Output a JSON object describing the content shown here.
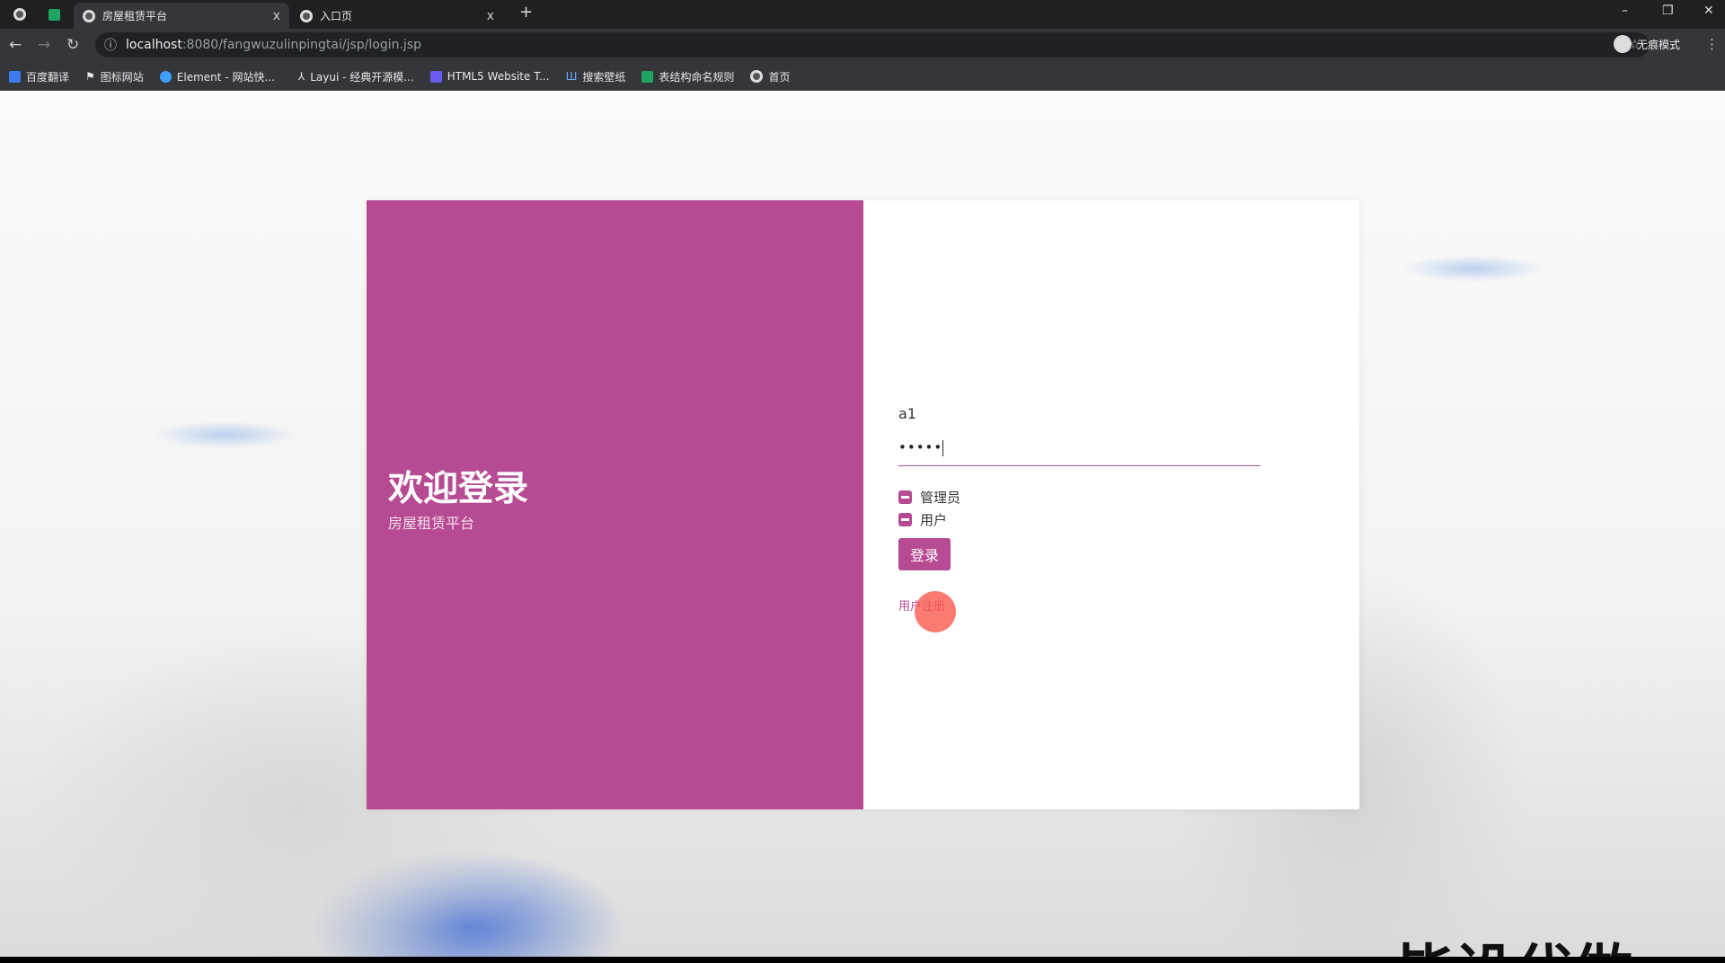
{
  "browser": {
    "tabs": [
      {
        "title": "房屋租赁平台",
        "active": true
      },
      {
        "title": "入口页",
        "active": false
      }
    ],
    "new_tab": "+",
    "close": "x",
    "url_host": "localhost",
    "url_rest": ":8080/fangwuzulinpingtai/jsp/login.jsp",
    "profile": "无痕模式",
    "bookmarks": [
      "百度翻译",
      "图标网站",
      "Element - 网站快...",
      "Layui - 经典开源模...",
      "HTML5 Website T...",
      "搜索壁纸",
      "表结构命名规则",
      "首页"
    ]
  },
  "login": {
    "title": "欢迎登录",
    "subtitle": "房屋租赁平台",
    "username": "a1",
    "password_mask": "•••••",
    "roles": [
      "管理员",
      "用户"
    ],
    "submit": "登录",
    "register_link": "用户注册",
    "accent": "#b64a93"
  },
  "watermark": "毕设代做"
}
